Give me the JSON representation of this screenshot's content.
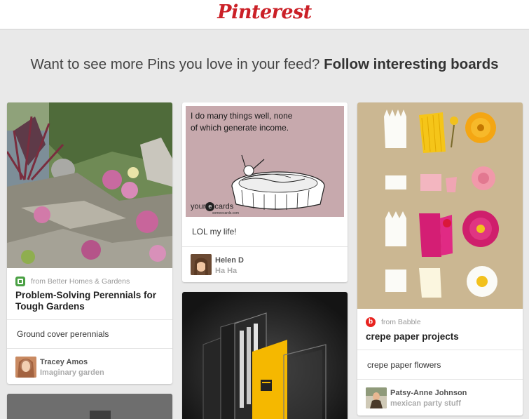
{
  "header": {
    "logo_text": "Pinterest"
  },
  "headline": {
    "prefix": "Want to see more Pins you love in your feed?",
    "link": "Follow interesting boards"
  },
  "pins": [
    {
      "source": "from Better Homes & Gardens",
      "title": "Problem-Solving Perennials for Tough Gardens",
      "description": "Ground cover perennials",
      "pinner": "Tracey Amos",
      "board": "Imaginary garden"
    },
    {
      "ecard_text": "I do many things well, none of which generate income.",
      "ecard_brand_prefix": "your",
      "ecard_brand_suffix": "cards",
      "ecard_site": "someecards.com",
      "description": "LOL my life!",
      "pinner": "Helen D",
      "board": "Ha Ha"
    },
    {
      "source": "from Babble",
      "title": "crepe paper projects",
      "description": "crepe paper flowers",
      "pinner": "Patsy-Anne Johnson",
      "board": "mexican party stuff"
    }
  ],
  "colors": {
    "brand": "#cb2027",
    "background": "#e9e9e9"
  }
}
